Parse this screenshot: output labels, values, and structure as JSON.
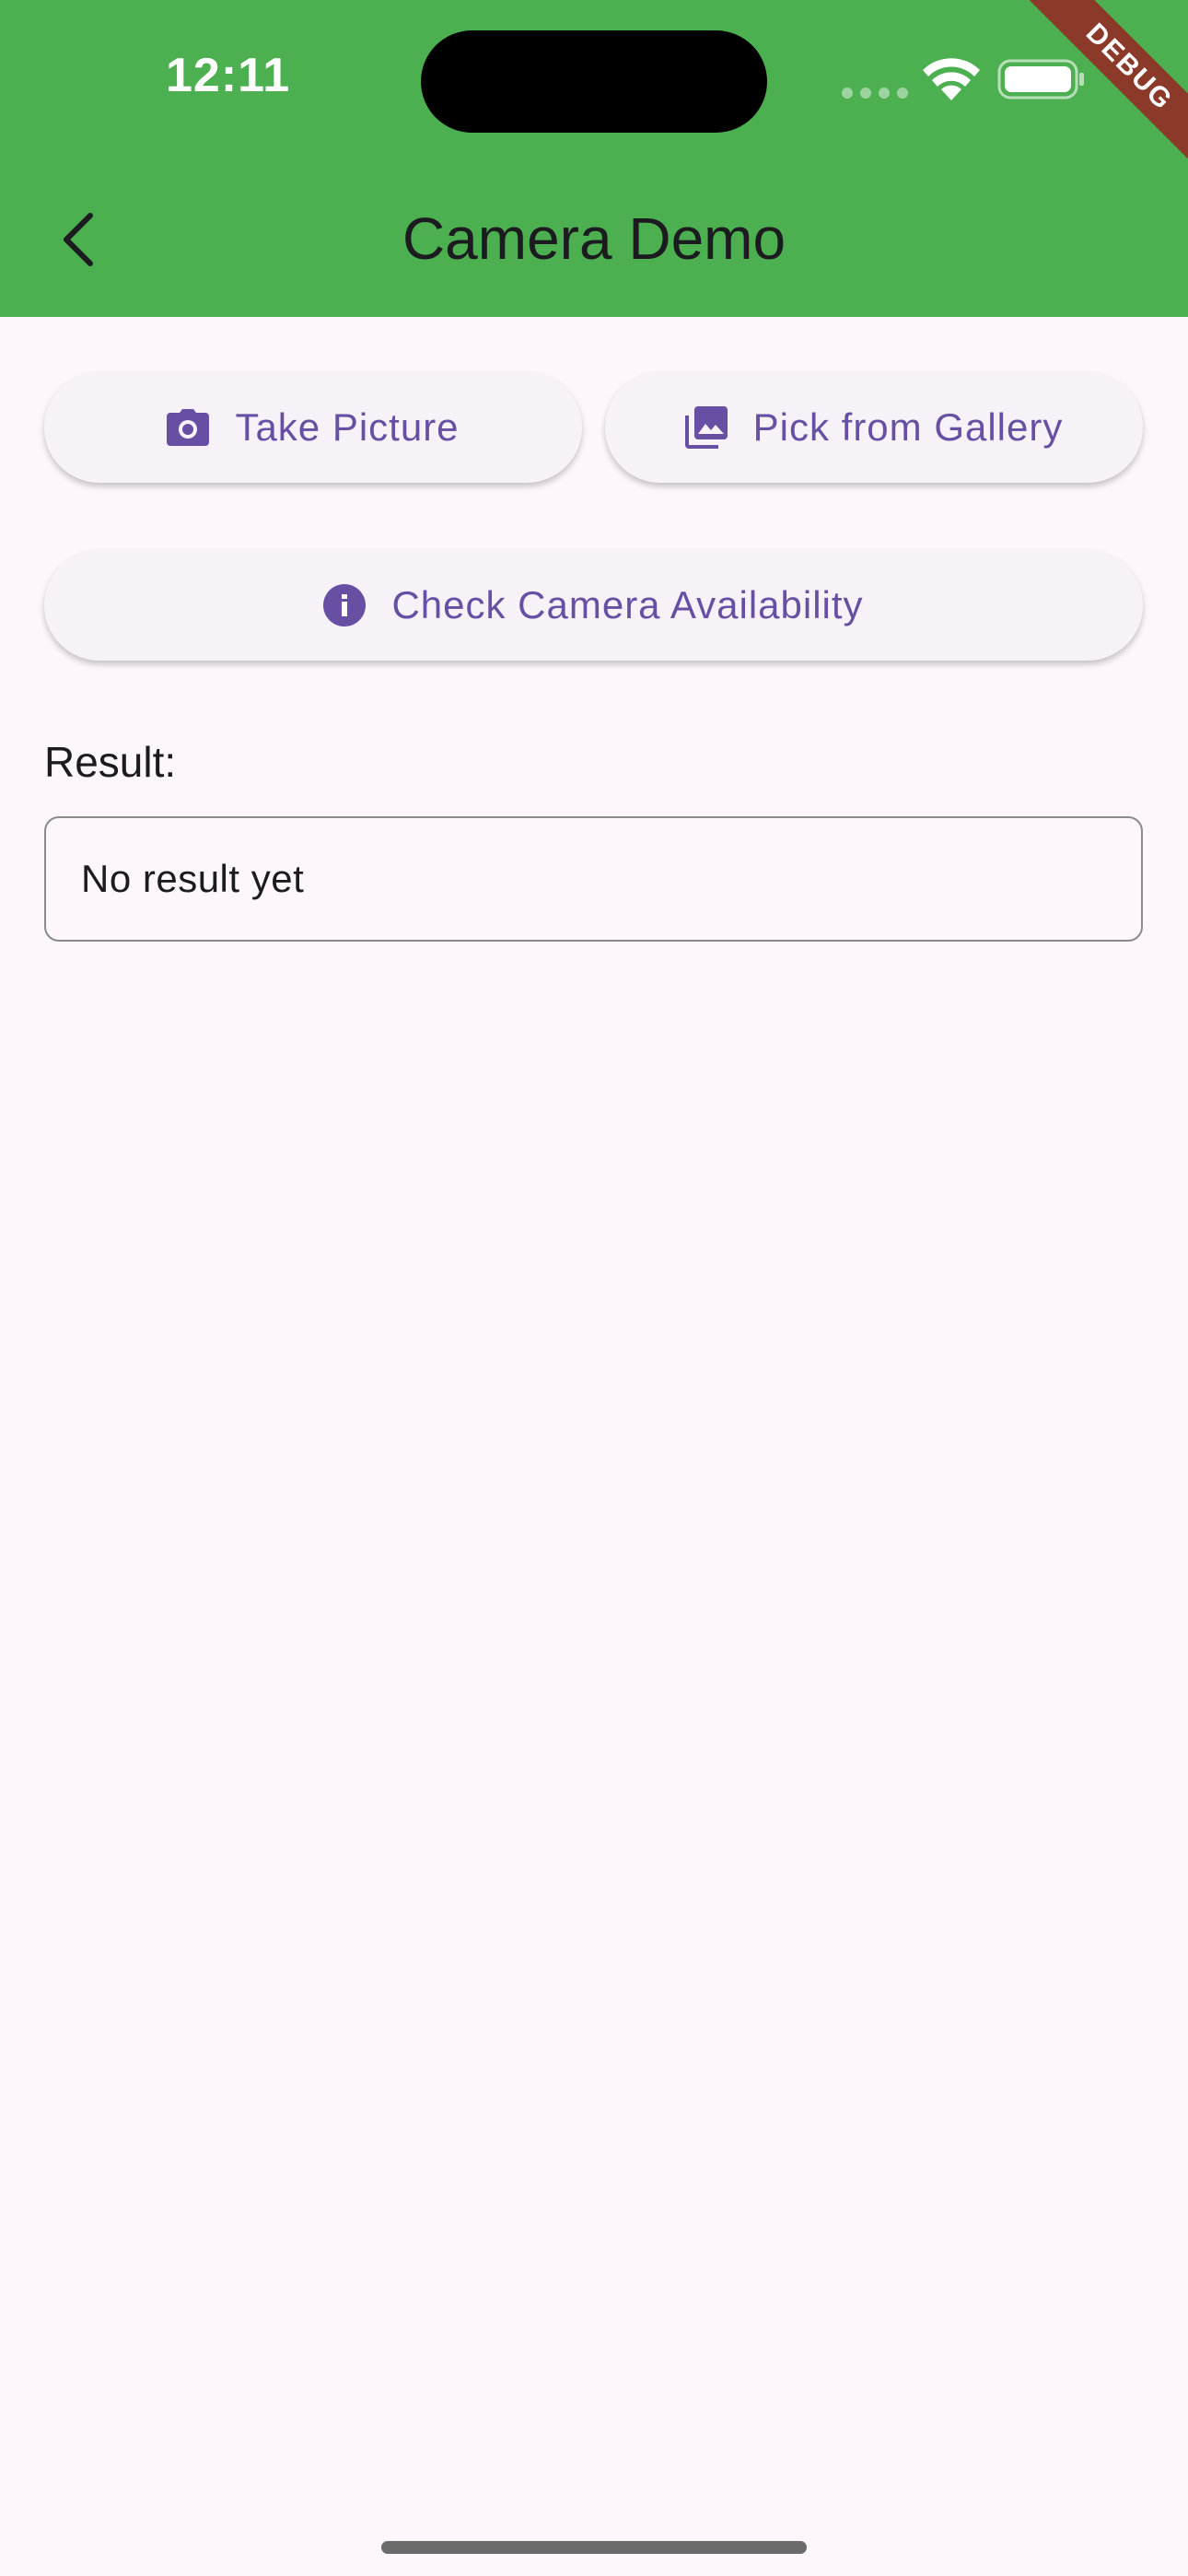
{
  "status_bar": {
    "time": "12:11"
  },
  "debug_banner": {
    "label": "DEBUG"
  },
  "app_bar": {
    "title": "Camera Demo",
    "back_icon": "chevron-left-icon"
  },
  "actions": {
    "take_picture": {
      "label": "Take Picture",
      "icon": "camera-icon"
    },
    "pick_gallery": {
      "label": "Pick from Gallery",
      "icon": "photo-library-icon"
    },
    "check_camera": {
      "label": "Check Camera Availability",
      "icon": "info-icon"
    }
  },
  "result": {
    "label": "Result:",
    "value": "No result yet"
  },
  "colors": {
    "app_bar": "#4caf50",
    "accent": "#6750a4",
    "background": "#fdf7fd",
    "button_bg": "#f7f2f7",
    "debug_ribbon": "#8b3a2a"
  }
}
